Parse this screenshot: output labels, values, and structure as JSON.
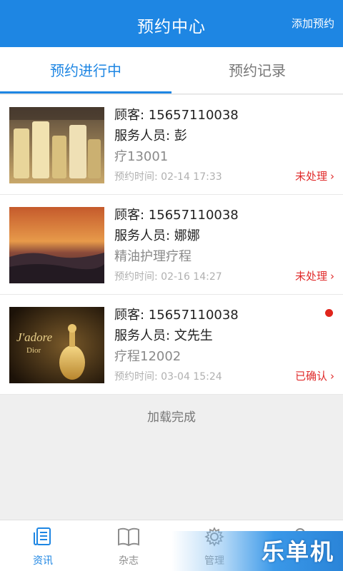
{
  "header": {
    "title": "预约中心",
    "add_label": "添加预约"
  },
  "tabs": [
    {
      "label": "预约进行中",
      "active": true
    },
    {
      "label": "预约记录",
      "active": false
    }
  ],
  "appointments": [
    {
      "customer": "顾客: 15657110038",
      "staff": "服务人员: 彭",
      "service": "疗13001",
      "time": "预约时间: 02-14 17:33",
      "status": "未处理",
      "image": "skincare-bottles-photo"
    },
    {
      "customer": "顾客: 15657110038",
      "staff": "服务人员: 娜娜",
      "service": "精油护理疗程",
      "time": "预约时间: 02-16 14:27",
      "status": "未处理",
      "image": "sunset-landscape-photo"
    },
    {
      "customer": "顾客: 15657110038",
      "staff": "服务人员: 文先生",
      "service": "疗程12002",
      "time": "预约时间: 03-04 15:24",
      "status": "已确认",
      "image": "perfume-bottle-photo",
      "unread": true
    }
  ],
  "list_footer": "加载完成",
  "bottom_nav": [
    {
      "label": "资讯",
      "icon": "news-icon",
      "active": true
    },
    {
      "label": "杂志",
      "icon": "book-icon",
      "active": false
    },
    {
      "label": "管理",
      "icon": "gear-icon",
      "active": false
    },
    {
      "label": "",
      "icon": "profile-icon",
      "active": false
    }
  ],
  "watermark": "乐单机",
  "colors": {
    "primary": "#1e86e3",
    "status_red": "#e02a2a",
    "background": "#efefef"
  }
}
